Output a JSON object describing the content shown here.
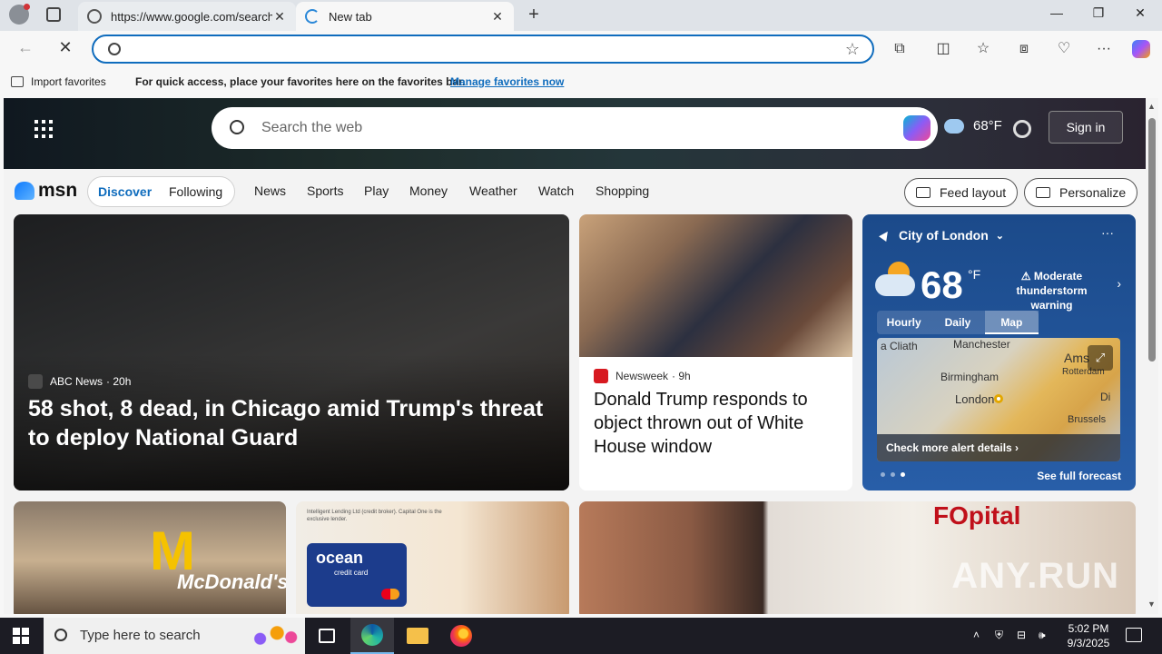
{
  "browser": {
    "tabs": [
      {
        "title": "https://www.google.com/search?q",
        "close": "✕"
      },
      {
        "title": "New tab",
        "close": "✕"
      }
    ],
    "new_tab": "+",
    "window_controls": {
      "minimize": "—",
      "restore": "❐",
      "close": "✕"
    },
    "address_value": "",
    "favorites_bar": {
      "import_label": "Import favorites",
      "message": "For quick access, place your favorites here on the favorites bar.",
      "link": "Manage favorites now"
    }
  },
  "msn": {
    "search_placeholder": "Search the web",
    "header_temp": "68°F",
    "signin": "Sign in",
    "logo": "msn",
    "tabs": {
      "discover": "Discover",
      "following": "Following"
    },
    "nav": [
      "News",
      "Sports",
      "Play",
      "Money",
      "Weather",
      "Watch",
      "Shopping"
    ],
    "feed_layout": "Feed layout",
    "personalize": "Personalize"
  },
  "cards": {
    "main": {
      "source": "ABC News",
      "age": "· 20h",
      "headline": "58 shot, 8 dead, in Chicago amid Trump's threat to deploy National Guard",
      "source_color": "#4a4a4a"
    },
    "second": {
      "source": "Newsweek",
      "age": "· 9h",
      "headline": "Donald Trump responds to object thrown out of White House window",
      "source_color": "#d71920"
    },
    "ad": {
      "fine_print": "Intelligent Lending Ltd (credit broker). Capital One is the exclusive lender.",
      "card_brand": "ocean",
      "card_sub": "credit card"
    },
    "mcd_sign": "McDonald's",
    "brand_fragment": "FOpital"
  },
  "weather": {
    "location": "City of London",
    "temp": "68",
    "unit": "°F",
    "alert": "⚠ Moderate thunderstorm warning",
    "modes": [
      "Hourly",
      "Daily",
      "Map"
    ],
    "active_mode": "Map",
    "map_cities": [
      "a Cliath",
      "Manchester",
      "Birmingham",
      "London",
      "Ams",
      "Rotterdam",
      "Brussels",
      "Di"
    ],
    "map_alert": "Check more alert details ›",
    "forecast_link": "See full forecast",
    "more": "···"
  },
  "watermark": "ANY.RUN",
  "taskbar": {
    "search_placeholder": "Type here to search",
    "time": "5:02 PM",
    "date": "9/3/2025"
  }
}
